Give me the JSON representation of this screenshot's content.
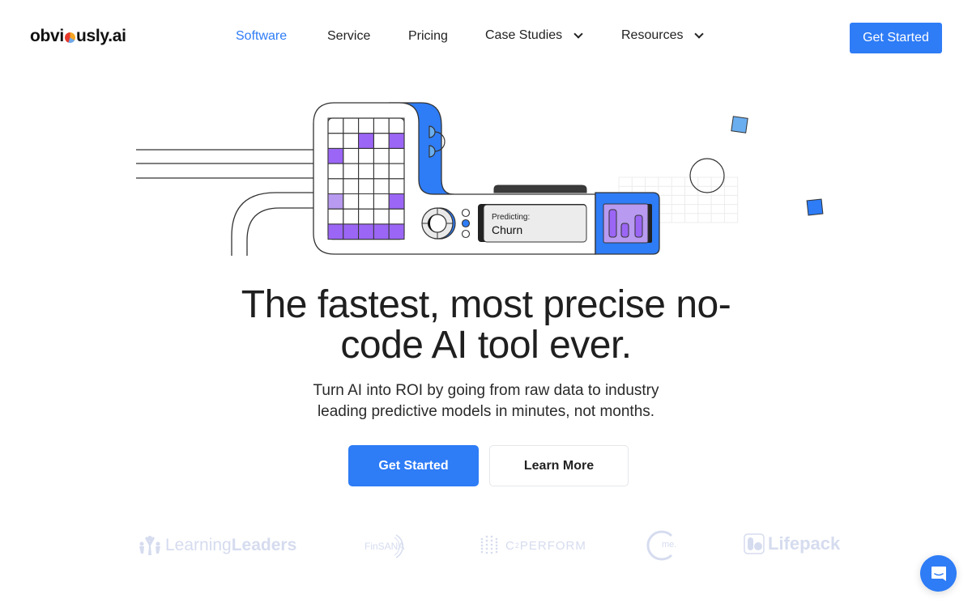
{
  "brand": {
    "name_before": "obvi",
    "name_after": "usly.ai",
    "accent_color": "#2e7cf6",
    "logo_icon": "pie-chart-icon"
  },
  "nav": {
    "items": [
      {
        "label": "Software",
        "active": true,
        "dropdown": false
      },
      {
        "label": "Service",
        "active": false,
        "dropdown": false
      },
      {
        "label": "Pricing",
        "active": false,
        "dropdown": false
      },
      {
        "label": "Case Studies",
        "active": false,
        "dropdown": true
      },
      {
        "label": "Resources",
        "active": false,
        "dropdown": true
      }
    ],
    "cta_label": "Get Started"
  },
  "illustration": {
    "predict_label": "Predicting:",
    "predict_value": "Churn",
    "grid": {
      "rows": 8,
      "cols": 5,
      "filled": [
        [
          1,
          2
        ],
        [
          1,
          4
        ],
        [
          2,
          0
        ],
        [
          5,
          4
        ],
        [
          7,
          0
        ],
        [
          7,
          1
        ],
        [
          7,
          2
        ],
        [
          7,
          3
        ],
        [
          7,
          4
        ]
      ],
      "light": [
        [
          5,
          0
        ]
      ]
    },
    "colors": {
      "blue": "#2e7cf6",
      "light_blue": "#6aaef0",
      "purple": "#9b66f5",
      "light_purple": "#b89af0"
    }
  },
  "hero": {
    "headline_line1": "The fastest, most precise no-",
    "headline_line2": "code AI tool ever.",
    "sub_line1": "Turn AI into ROI by going from raw data to industry",
    "sub_line2": "leading predictive models in minutes, not months.",
    "primary_label": "Get Started",
    "secondary_label": "Learn More"
  },
  "clients": {
    "learning_a": "Learning",
    "learning_b": "Leaders",
    "finsana": "FinSANA",
    "c2_prefix": "C",
    "c2_sup": "2",
    "c2_suffix": "PERFORM",
    "me": "me.",
    "lifepack": "Lifepack"
  },
  "chat": {
    "icon": "chat-bubble-icon"
  }
}
